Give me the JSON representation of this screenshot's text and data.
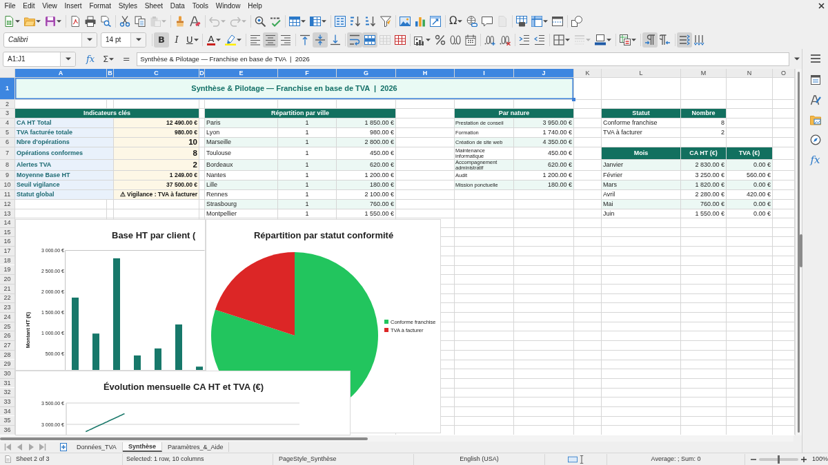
{
  "menu": [
    "File",
    "Edit",
    "View",
    "Insert",
    "Format",
    "Styles",
    "Sheet",
    "Data",
    "Tools",
    "Window",
    "Help"
  ],
  "standard_toolbar": [
    {
      "disabled": false
    },
    {
      "disabled": false
    },
    {
      "disabled": false
    },
    {
      "disabled": false
    },
    {
      "disabled": false
    },
    {
      "disabled": false
    },
    {
      "disabled": false
    },
    {
      "disabled": false
    },
    {
      "disabled": true
    },
    {
      "disabled": false
    },
    {
      "disabled": false
    },
    {
      "disabled": true
    },
    {
      "disabled": true
    },
    {
      "disabled": false
    },
    {
      "disabled": false
    },
    {
      "disabled": false
    },
    {
      "disabled": false
    },
    {
      "disabled": false
    },
    {
      "disabled": false
    },
    {
      "disabled": false
    },
    {
      "disabled": false
    },
    {
      "disabled": false
    },
    {
      "disabled": false
    },
    {
      "disabled": false
    },
    {
      "label": "Ω",
      "disabled": false
    },
    {
      "disabled": false
    },
    {
      "disabled": false
    },
    {
      "disabled": true
    },
    {
      "disabled": false
    },
    {
      "disabled": false
    },
    {
      "disabled": false
    },
    {
      "disabled": false
    }
  ],
  "formatting_toolbar": {
    "font_name": "Calibri",
    "font_size": "14 pt",
    "buttons": [
      {
        "label": "B",
        "on": true,
        "disabled": false
      },
      {
        "label": "I",
        "on": false,
        "disabled": false
      },
      {
        "label": "U",
        "on": false,
        "disabled": false
      },
      {
        "label": "A",
        "on": false,
        "disabled": false
      },
      {
        "on": false,
        "disabled": false
      },
      {
        "on": false,
        "disabled": false
      },
      {
        "on": true,
        "disabled": false
      },
      {
        "on": false,
        "disabled": false
      },
      {
        "on": false,
        "disabled": false
      },
      {
        "on": true,
        "disabled": false
      },
      {
        "on": false,
        "disabled": false
      },
      {
        "on": true,
        "disabled": false
      },
      {
        "on": true,
        "disabled": false
      },
      {
        "on": false,
        "disabled": true
      },
      {
        "on": false,
        "disabled": false
      },
      {
        "on": false,
        "disabled": false
      },
      {
        "on": false,
        "disabled": false
      },
      {
        "on": false,
        "disabled": false
      },
      {
        "on": false,
        "disabled": false
      },
      {
        "on": false,
        "disabled": false
      },
      {
        "on": false,
        "disabled": false
      },
      {
        "on": false,
        "disabled": false
      },
      {
        "on": false,
        "disabled": false
      },
      {
        "on": false,
        "disabled": false
      },
      {
        "on": false,
        "disabled": true
      },
      {
        "on": false,
        "disabled": false
      },
      {
        "on": false,
        "disabled": false
      },
      {
        "on": true,
        "disabled": false
      },
      {
        "on": false,
        "disabled": false
      },
      {
        "on": true,
        "disabled": false
      },
      {
        "on": false,
        "disabled": false
      }
    ]
  },
  "formula_bar": {
    "name_box": "A1:J1",
    "wizard_label": "fx",
    "sum_label": "Σ",
    "equals_label": "=",
    "content": "Synthèse & Pilotage — Franchise en base de TVA  |  2026"
  },
  "sidebar": {
    "functions_label": "fx"
  },
  "columns": [
    {
      "label": "A",
      "selected": true
    },
    {
      "label": "B",
      "selected": true
    },
    {
      "label": "C",
      "selected": true
    },
    {
      "label": "D",
      "selected": true
    },
    {
      "label": "E",
      "selected": true
    },
    {
      "label": "F",
      "selected": true
    },
    {
      "label": "G",
      "selected": true
    },
    {
      "label": "H",
      "selected": true
    },
    {
      "label": "I",
      "selected": true
    },
    {
      "label": "J",
      "selected": true
    },
    {
      "label": "K",
      "selected": false
    },
    {
      "label": "L",
      "selected": false
    },
    {
      "label": "M",
      "selected": false
    },
    {
      "label": "N",
      "selected": false
    },
    {
      "label": "O",
      "selected": false
    }
  ],
  "rows": [
    {
      "label": "1",
      "selected": true
    },
    {
      "label": "2",
      "selected": false
    },
    {
      "label": "3",
      "selected": false
    },
    {
      "label": "4",
      "selected": false
    },
    {
      "label": "5",
      "selected": false
    },
    {
      "label": "6",
      "selected": false
    },
    {
      "label": "7",
      "selected": false
    },
    {
      "label": "8",
      "selected": false
    },
    {
      "label": "9",
      "selected": false
    },
    {
      "label": "10",
      "selected": false
    },
    {
      "label": "11",
      "selected": false
    },
    {
      "label": "12",
      "selected": false
    },
    {
      "label": "13",
      "selected": false
    },
    {
      "label": "14",
      "selected": false
    },
    {
      "label": "15",
      "selected": false
    },
    {
      "label": "16",
      "selected": false
    },
    {
      "label": "17",
      "selected": false
    },
    {
      "label": "18",
      "selected": false
    },
    {
      "label": "19",
      "selected": false
    },
    {
      "label": "20",
      "selected": false
    },
    {
      "label": "21",
      "selected": false
    },
    {
      "label": "22",
      "selected": false
    },
    {
      "label": "23",
      "selected": false
    },
    {
      "label": "24",
      "selected": false
    },
    {
      "label": "25",
      "selected": false
    },
    {
      "label": "26",
      "selected": false
    },
    {
      "label": "27",
      "selected": false
    },
    {
      "label": "28",
      "selected": false
    },
    {
      "label": "29",
      "selected": false
    },
    {
      "label": "30",
      "selected": false
    },
    {
      "label": "31",
      "selected": false
    },
    {
      "label": "32",
      "selected": false
    },
    {
      "label": "33",
      "selected": false
    },
    {
      "label": "34",
      "selected": false
    },
    {
      "label": "35",
      "selected": false
    },
    {
      "label": "36",
      "selected": false
    }
  ],
  "sheet": {
    "title": "Synthèse & Pilotage — Franchise en base de TVA  |  2026",
    "indicators": {
      "header": "Indicateurs clés",
      "rows": [
        {
          "label": "CA HT Total",
          "value": "12 490.00 €"
        },
        {
          "label": "TVA facturée totale",
          "value": "980.00 €"
        },
        {
          "label": "Nbre d'opérations",
          "value": "10"
        },
        {
          "label": "Opérations conformes",
          "value": "8"
        },
        {
          "label": "Alertes TVA",
          "value": "2"
        },
        {
          "label": "Moyenne Base HT",
          "value": "1 249.00 €"
        },
        {
          "label": "Seuil vigilance",
          "value": "37 500.00 €"
        },
        {
          "label": "Statut global",
          "value": "⚠ Vigilance : TVA à facturer"
        }
      ]
    },
    "by_city": {
      "header": "Répartition par ville",
      "rows": [
        {
          "city": "Paris",
          "count": "1",
          "amount": "1 850.00 €"
        },
        {
          "city": "Lyon",
          "count": "1",
          "amount": "980.00 €"
        },
        {
          "city": "Marseille",
          "count": "1",
          "amount": "2 800.00 €"
        },
        {
          "city": "Toulouse",
          "count": "1",
          "amount": "450.00 €"
        },
        {
          "city": "Bordeaux",
          "count": "1",
          "amount": "620.00 €"
        },
        {
          "city": "Nantes",
          "count": "1",
          "amount": "1 200.00 €"
        },
        {
          "city": "Lille",
          "count": "1",
          "amount": "180.00 €"
        },
        {
          "city": "Rennes",
          "count": "1",
          "amount": "2 100.00 €"
        },
        {
          "city": "Strasbourg",
          "count": "1",
          "amount": "760.00 €"
        },
        {
          "city": "Montpellier",
          "count": "1",
          "amount": "1 550.00 €"
        }
      ]
    },
    "by_nature": {
      "header": "Par nature",
      "rows": [
        {
          "nature": "Prestation de conseil",
          "amount": "3 950.00 €"
        },
        {
          "nature": "Formation",
          "amount": "1 740.00 €"
        },
        {
          "nature": "Création de site web",
          "amount": "4 350.00 €"
        },
        {
          "nature": "Maintenance informatique",
          "amount": "450.00 €"
        },
        {
          "nature": "Accompagnement administratif",
          "amount": "620.00 €"
        },
        {
          "nature": "Audit",
          "amount": "1 200.00 €"
        },
        {
          "nature": "Mission ponctuelle",
          "amount": "180.00 €"
        }
      ]
    },
    "by_status": {
      "columns": [
        "Statut",
        "Nombre"
      ],
      "rows": [
        {
          "status": "Conforme franchise",
          "count": "8"
        },
        {
          "status": "TVA à facturer",
          "count": "2"
        }
      ]
    },
    "by_month": {
      "columns": [
        "Mois",
        "CA HT (€)",
        "TVA (€)"
      ],
      "rows": [
        {
          "month": "Janvier",
          "ca_ht": "2 830.00 €",
          "tva": "0.00 €"
        },
        {
          "month": "Février",
          "ca_ht": "3 250.00 €",
          "tva": "560.00 €"
        },
        {
          "month": "Mars",
          "ca_ht": "1 820.00 €",
          "tva": "0.00 €"
        },
        {
          "month": "Avril",
          "ca_ht": "2 280.00 €",
          "tva": "420.00 €"
        },
        {
          "month": "Mai",
          "ca_ht": "760.00 €",
          "tva": "0.00 €"
        },
        {
          "month": "Juin",
          "ca_ht": "1 550.00 €",
          "tva": "0.00 €"
        }
      ]
    }
  },
  "charts": [
    {
      "chart_data": {
        "type": "bar",
        "title": "Base HT par client (",
        "ylabel": "Montant HT (€)",
        "categories": [
          null,
          null,
          null,
          null,
          null,
          null,
          null
        ],
        "ylim": [
          100,
          3000
        ],
        "series": [
          {
            "color": "#17786a",
            "values": [
              1850,
              980,
              2800,
              450,
              620,
              1200,
              180
            ]
          }
        ],
        "yticks": [
          {
            "value": 500,
            "label": "500.00 €"
          },
          {
            "value": 1000,
            "label": "1 000.00 €"
          },
          {
            "value": 1500,
            "label": "1 500.00 €"
          },
          {
            "value": 2000,
            "label": "2 000.00 €"
          },
          {
            "value": 2500,
            "label": "2 500.00 €"
          },
          {
            "value": 3000,
            "label": "3 000.00 €"
          }
        ]
      }
    },
    {
      "chart_data": {
        "type": "pie",
        "title": "Répartition par statut conformité",
        "categories": [
          "Conforme franchise",
          "TVA à facturer"
        ],
        "values": [
          80,
          20
        ],
        "legend": "right"
      },
      "slices": [
        {
          "color": "#22c55e"
        },
        {
          "color": "#dc2626"
        }
      ]
    },
    {
      "chart_data": {
        "type": "line",
        "title": "Évolution mensuelle CA HT et TVA (€)",
        "categories": [
          null,
          null,
          null,
          null,
          null,
          null
        ],
        "ylim": [
          2730,
          3500
        ],
        "series": [
          {
            "color": "#1d7a6c",
            "values": [
              2830,
              3250,
              null,
              null,
              null,
              null
            ]
          }
        ],
        "yticks": [
          {
            "value": 3000,
            "label": "3 000.00 €"
          },
          {
            "value": 3500,
            "label": "3 500.00 €"
          }
        ]
      }
    }
  ],
  "sheet_tabs": [
    {
      "label": "Données_TVA",
      "selected": false
    },
    {
      "label": "Synthèse",
      "selected": true
    },
    {
      "label": "Paramètres_&_Aide",
      "selected": false
    }
  ],
  "status_bar": {
    "sheet": "Sheet 2 of 3",
    "selection": "Selected: 1 row, 10 columns",
    "page_style": "PageStyle_Synthèse",
    "language": "English (USA)",
    "summary": "Average: ; Sum: 0",
    "zoom": {
      "level": 0.5,
      "label": "100%"
    }
  }
}
